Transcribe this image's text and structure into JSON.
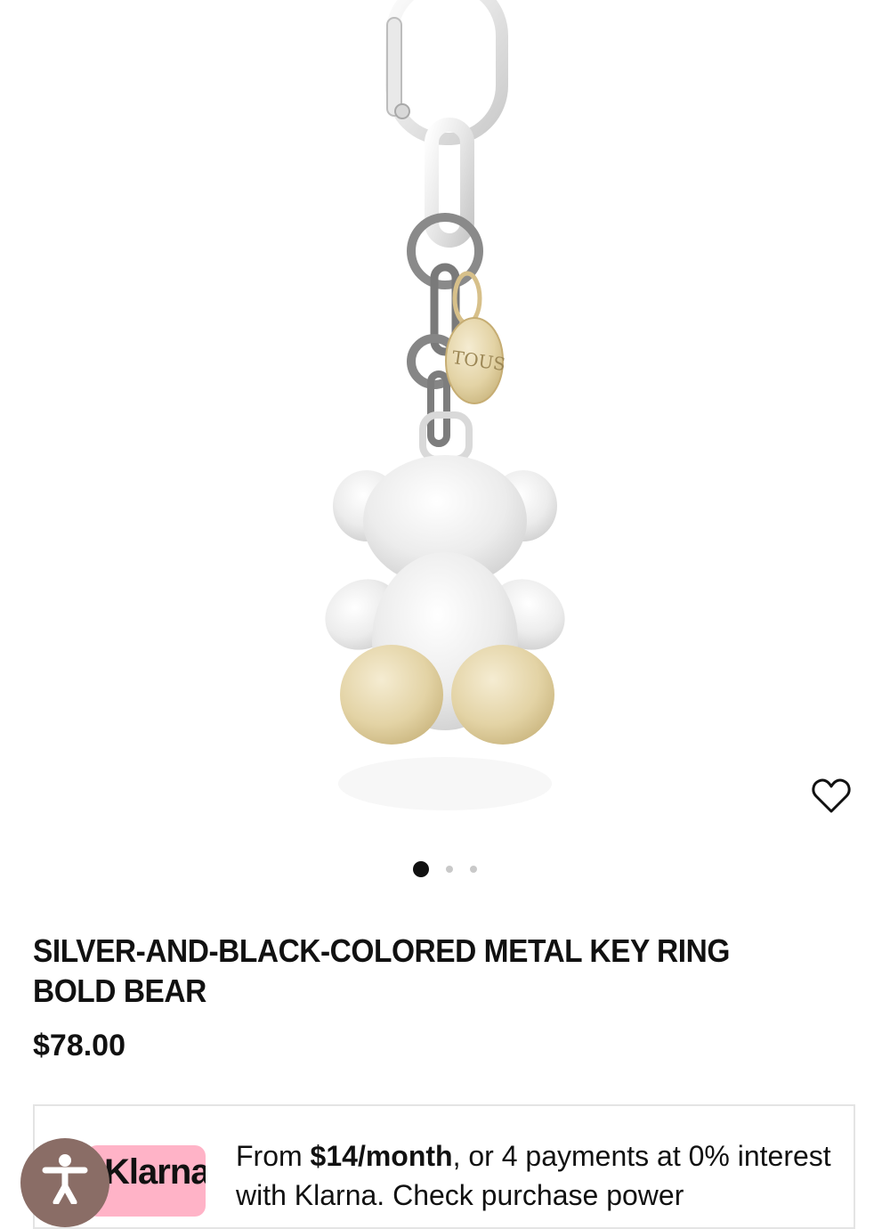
{
  "product": {
    "title": "SILVER-AND-BLACK-COLORED METAL KEY RING BOLD BEAR",
    "price": "$78.00",
    "tag_engraving": "TOUS",
    "image_icon": "bear-keyring-image"
  },
  "gallery": {
    "slide_count": 3,
    "active_slide": 1,
    "wishlist_icon": "heart-icon"
  },
  "klarna": {
    "logo_text": "Klarna",
    "message_prefix": "From ",
    "monthly_amount": "$14/month",
    "message_suffix": ", or 4 payments at 0% interest with Klarna. Check purchase power"
  },
  "accessibility": {
    "icon": "accessibility-icon"
  },
  "colors": {
    "text": "#111111",
    "klarna_pink": "#ffb3c7",
    "accessibility_button": "#8a6d66",
    "dot_inactive": "#c9c9c9"
  }
}
